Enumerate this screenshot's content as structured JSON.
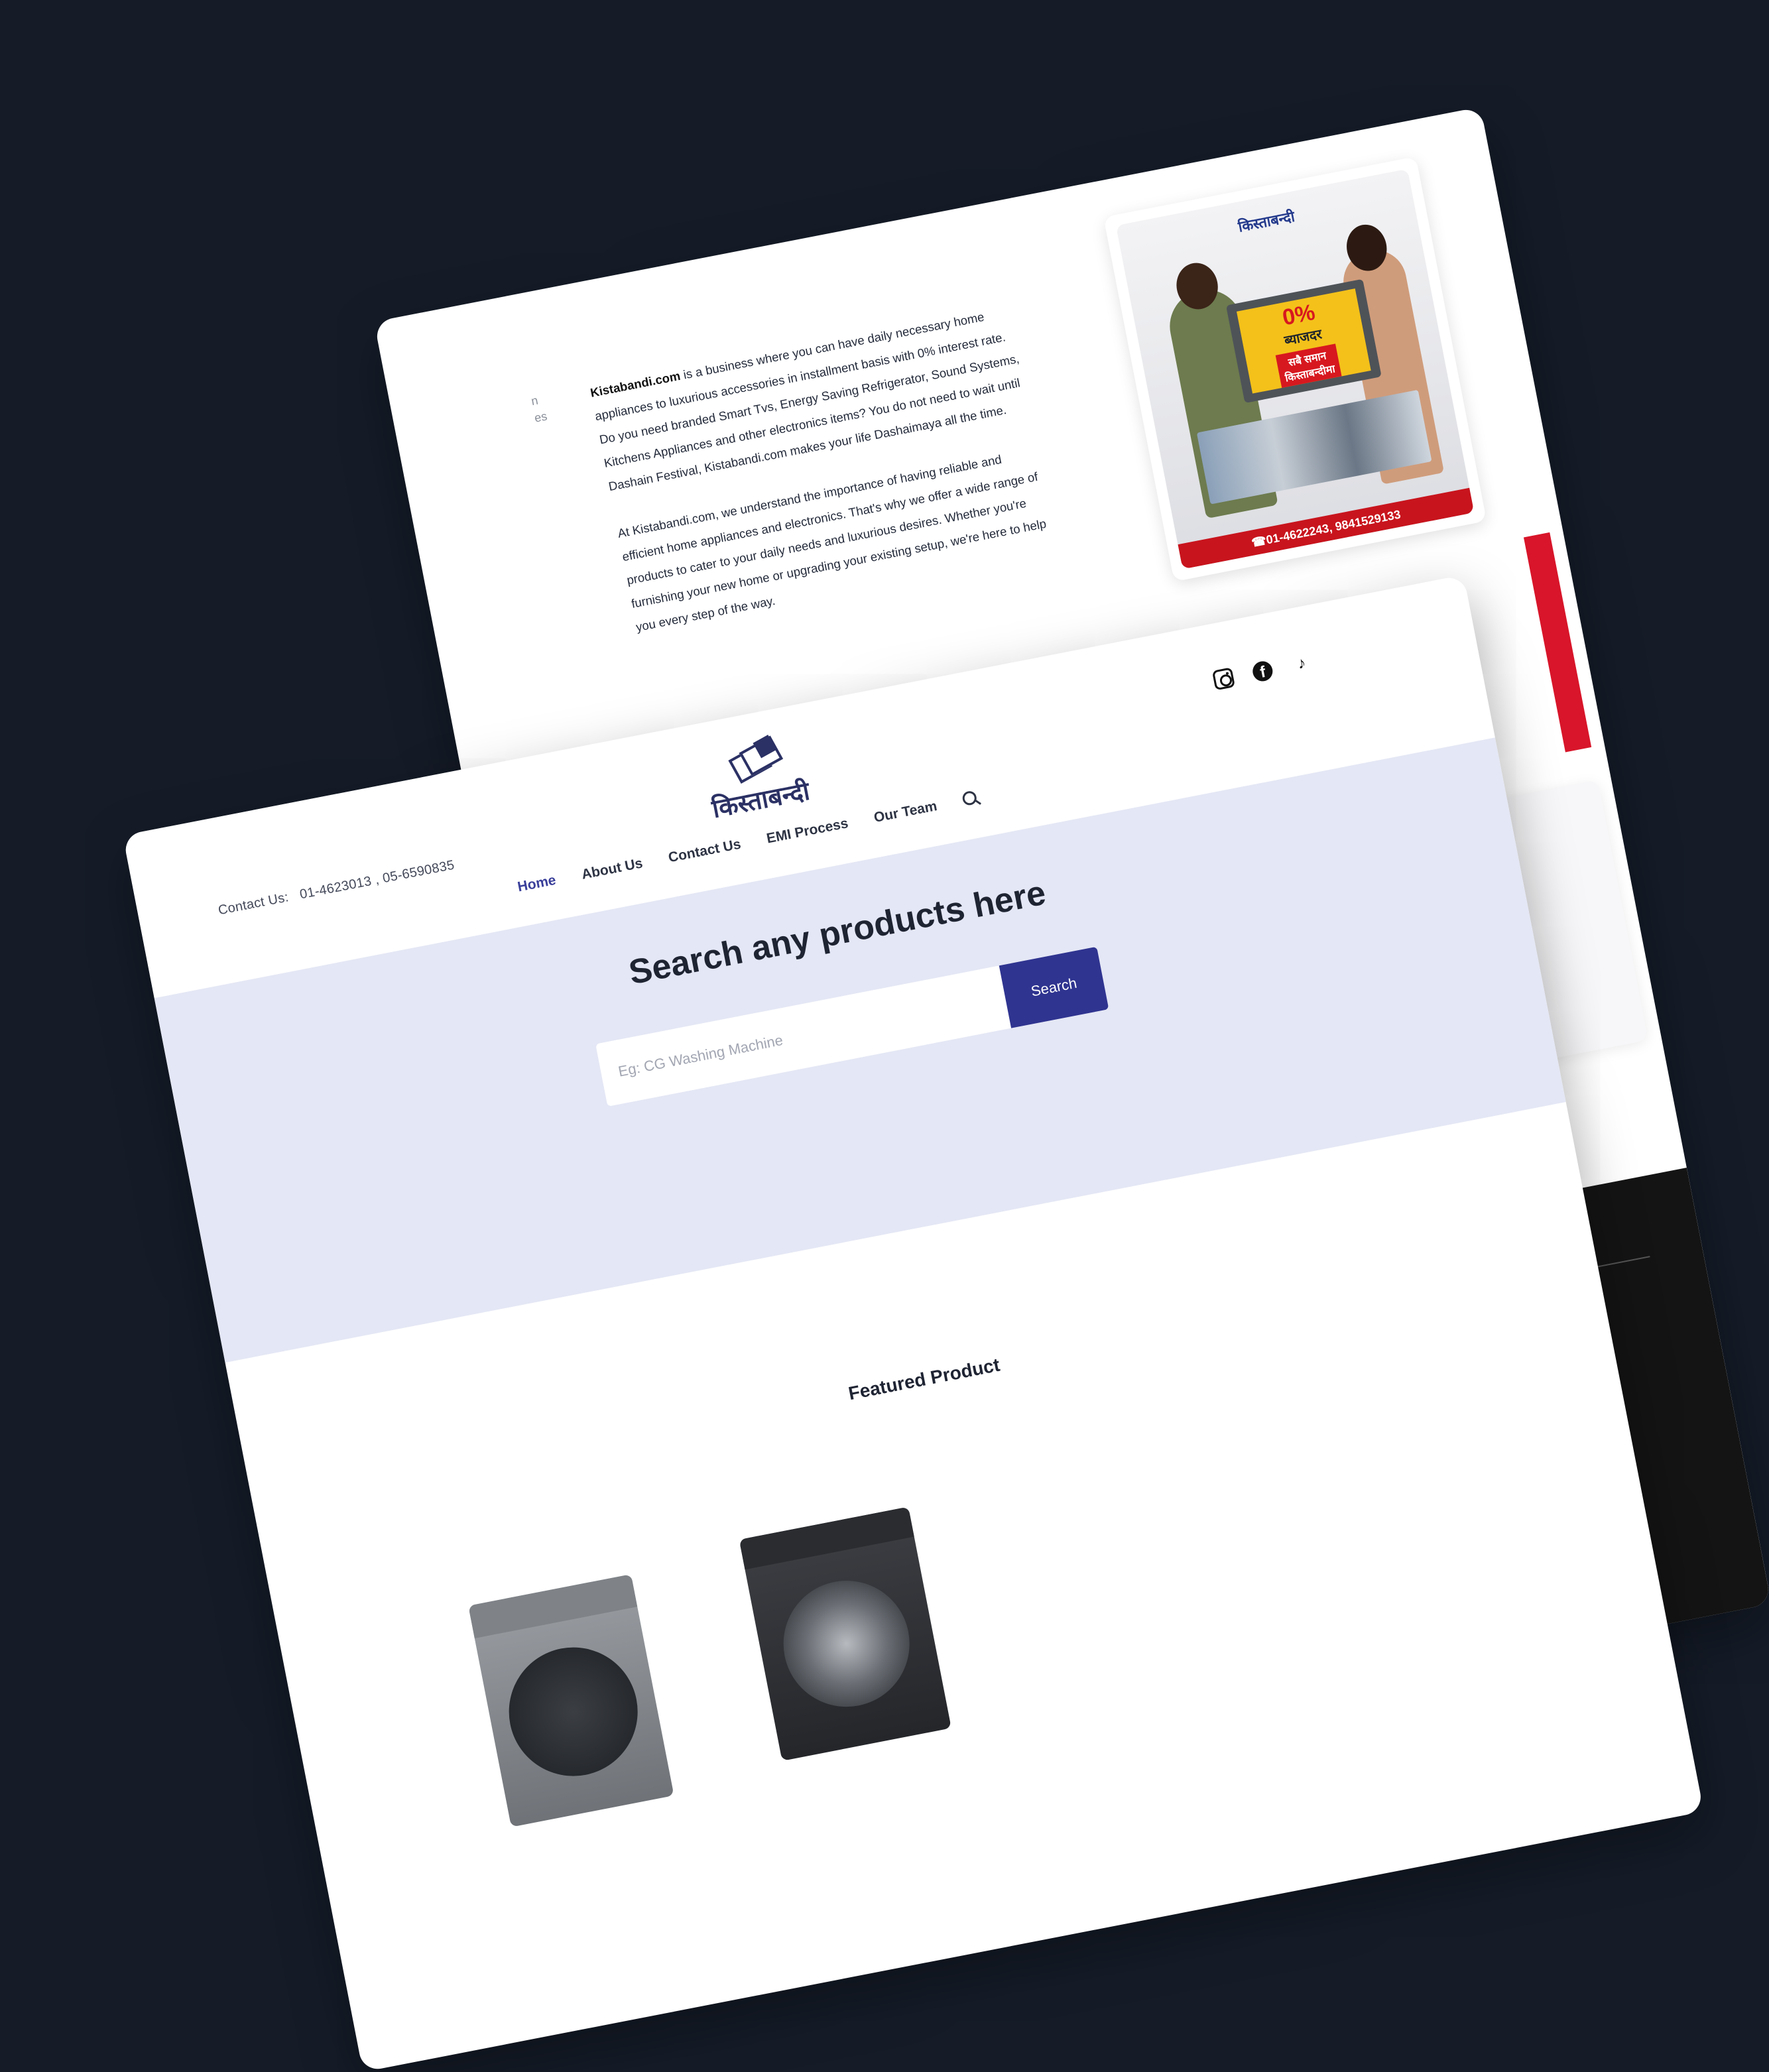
{
  "about": {
    "brand": "Kistabandi.com",
    "para1_rest": " is a business where you can have daily necessary home appliances to luxurious accessories in installment basis with 0% interest rate. Do you need branded Smart Tvs, Energy Saving Refrigerator, Sound Systems, Kitchens Appliances and other electronics items? You do not need to wait until Dashain Festival, Kistabandi.com makes your life Dashaimaya all the time.",
    "para2": "At Kistabandi.com, we understand the importance of having reliable and efficient home appliances and electronics. That's why we offer a wide range of products to cater to your daily needs and luxurious desires. Whether you're furnishing your new home or upgrading your existing setup, we're here to help you every step of the way."
  },
  "promo": {
    "logo_text": "किस्ताबन्दी",
    "percent": "0%",
    "line1": "ब्याजदर",
    "line2": "सबै समान",
    "line3": "किस्ताबन्दीमा",
    "phone": "☎01-4622243, 9841529133"
  },
  "ghost": {
    "line1": "n",
    "line2": "es"
  },
  "header": {
    "contact_label": "Contact Us:",
    "phones": "01-4623013 ,  05-6590835",
    "logo_text": "किस्ताबन्दी",
    "nav": [
      "Home",
      "About Us",
      "Contact Us",
      "EMI Process",
      "Our Team"
    ],
    "socials": {
      "tiktok": "♪",
      "facebook": "f"
    }
  },
  "hero": {
    "title": "Search any products here",
    "placeholder": "Eg: CG Washing Machine",
    "button": "Search"
  },
  "featured": {
    "title": "Featured Product"
  },
  "colors": {
    "background": "#151c28",
    "accent": "#2f3490",
    "hero_bg": "#e4e7f5",
    "promo_red": "#c8141d"
  }
}
